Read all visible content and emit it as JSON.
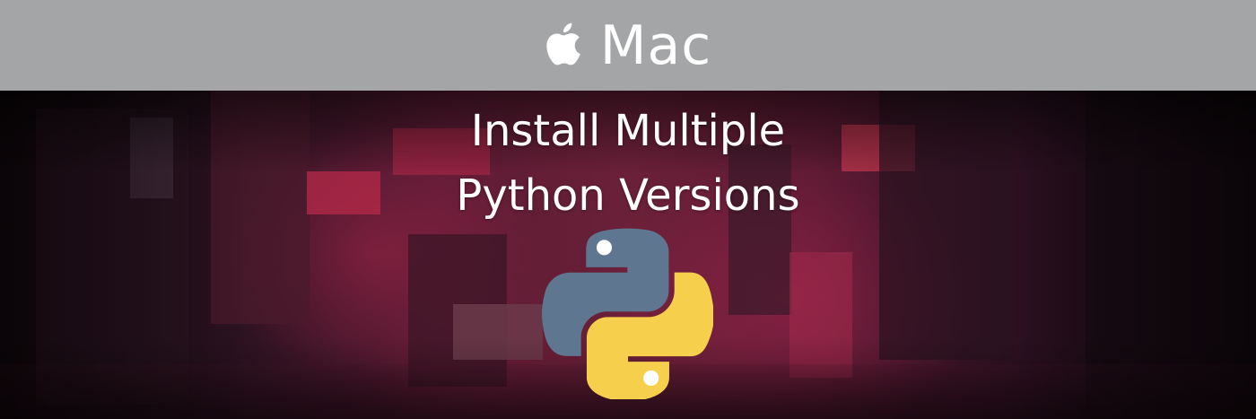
{
  "header": {
    "platform_label": "Mac",
    "platform_icon": "apple-icon",
    "bar_color": "#a3a5a6",
    "text_color": "#ffffff"
  },
  "headline": {
    "line1": "Install Multiple",
    "line2": "Python Versions"
  },
  "logo": {
    "icon": "python-logo-icon",
    "blue": "#5f7690",
    "yellow": "#f6d04d"
  }
}
